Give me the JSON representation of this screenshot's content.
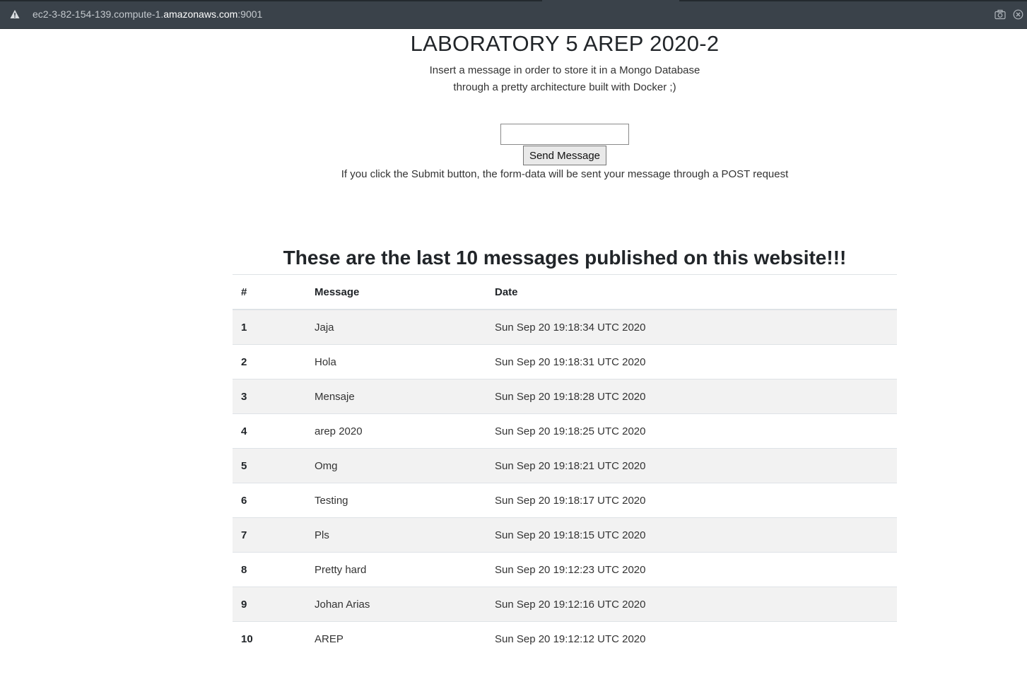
{
  "browser": {
    "url_prefix": "ec2-3-82-154-139.compute-1.",
    "url_host": "amazonaws.com",
    "url_suffix": ":9001",
    "warning_icon": "warning-triangle-icon",
    "screenshot_icon": "camera-icon",
    "close_icon": "close-circle-icon"
  },
  "page": {
    "title": "LABORATORY 5 AREP 2020-2",
    "subtitle_line1": "Insert a message in order to store it in a Mongo Database",
    "subtitle_line2": "through a pretty architecture built with Docker ;)",
    "input_value": "",
    "send_label": "Send Message",
    "hint": "If you click the Submit button, the form-data will be sent your message through a POST request",
    "list_heading": "These are the last 10 messages published on this website!!!"
  },
  "table": {
    "headers": [
      "#",
      "Message",
      "Date"
    ],
    "rows": [
      {
        "num": "1",
        "message": "Jaja",
        "date": "Sun Sep 20 19:18:34 UTC 2020"
      },
      {
        "num": "2",
        "message": "Hola",
        "date": "Sun Sep 20 19:18:31 UTC 2020"
      },
      {
        "num": "3",
        "message": "Mensaje",
        "date": "Sun Sep 20 19:18:28 UTC 2020"
      },
      {
        "num": "4",
        "message": "arep 2020",
        "date": "Sun Sep 20 19:18:25 UTC 2020"
      },
      {
        "num": "5",
        "message": "Omg",
        "date": "Sun Sep 20 19:18:21 UTC 2020"
      },
      {
        "num": "6",
        "message": "Testing",
        "date": "Sun Sep 20 19:18:17 UTC 2020"
      },
      {
        "num": "7",
        "message": "Pls",
        "date": "Sun Sep 20 19:18:15 UTC 2020"
      },
      {
        "num": "8",
        "message": "Pretty hard",
        "date": "Sun Sep 20 19:12:23 UTC 2020"
      },
      {
        "num": "9",
        "message": "Johan Arias",
        "date": "Sun Sep 20 19:12:16 UTC 2020"
      },
      {
        "num": "10",
        "message": "AREP",
        "date": "Sun Sep 20 19:12:12 UTC 2020"
      }
    ]
  }
}
